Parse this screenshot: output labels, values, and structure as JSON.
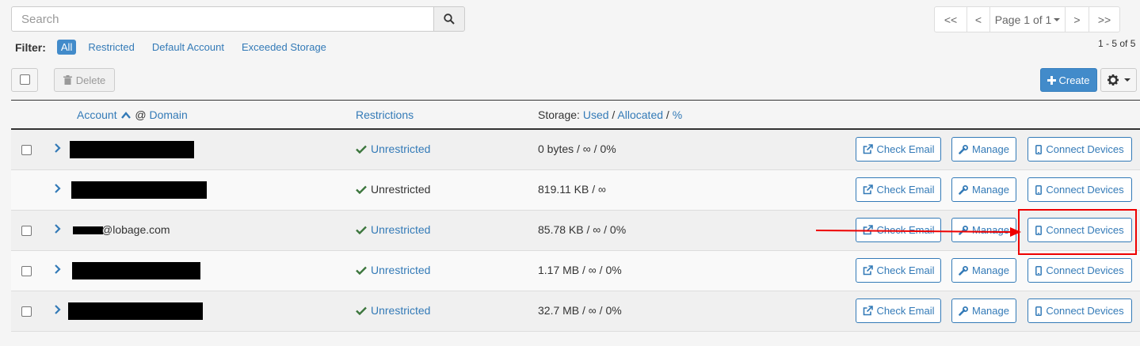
{
  "search": {
    "placeholder": "Search",
    "icon": "search-icon"
  },
  "pager": {
    "first": "<<",
    "prev": "<",
    "page_label": "Page 1 of 1",
    "next": ">",
    "last": ">>",
    "range": "1 - 5 of 5"
  },
  "filter": {
    "label": "Filter:",
    "all": "All",
    "restricted": "Restricted",
    "default_account": "Default Account",
    "exceeded_storage": "Exceeded Storage"
  },
  "toolbar": {
    "delete": "Delete",
    "create": "Create"
  },
  "table": {
    "account": "Account",
    "at": "@",
    "domain": "Domain",
    "restrictions": "Restrictions",
    "storage": "Storage:",
    "used": "Used",
    "allocated": "Allocated",
    "percent": "%",
    "sep": "/"
  },
  "rows": [
    {
      "account": "",
      "restriction": "Unrestricted",
      "storage": "0 bytes / ∞ / 0%"
    },
    {
      "account": "",
      "restriction": "Unrestricted",
      "storage": "819.11 KB / ∞"
    },
    {
      "account": "@lobage.com",
      "restriction": "Unrestricted",
      "storage": "85.78 KB / ∞ / 0%"
    },
    {
      "account": "",
      "restriction": "Unrestricted",
      "storage": "1.17 MB / ∞ / 0%"
    },
    {
      "account": "",
      "restriction": "Unrestricted",
      "storage": "32.7 MB / ∞ / 0%"
    }
  ],
  "actions": {
    "check_email": "Check Email",
    "manage": "Manage",
    "connect_devices": "Connect Devices"
  },
  "colors": {
    "primary": "#428bca",
    "link": "#337ab7",
    "success": "#3c763d",
    "annotation": "#e00000"
  }
}
